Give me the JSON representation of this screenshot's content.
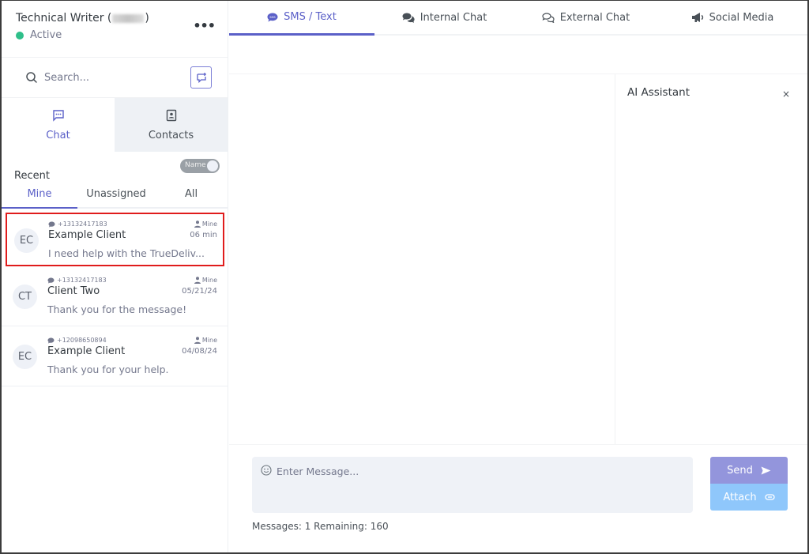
{
  "user": {
    "name_prefix": "Technical Writer (",
    "name_suffix": ")",
    "status": "Active",
    "status_color": "#2fbf8a",
    "more_icon": "ellipsis-icon"
  },
  "search": {
    "placeholder": "Search...",
    "value": "",
    "new_chat_icon": "new-message-icon"
  },
  "mode_tabs": [
    {
      "label": "Chat",
      "icon": "chat-icon",
      "active": true
    },
    {
      "label": "Contacts",
      "icon": "contact-book-icon",
      "active": false
    }
  ],
  "recent": {
    "label": "Recent",
    "toggle_label": "Name"
  },
  "filter_tabs": [
    {
      "label": "Mine",
      "active": true
    },
    {
      "label": "Unassigned",
      "active": false
    },
    {
      "label": "All",
      "active": false
    }
  ],
  "conversations": [
    {
      "initials": "EC",
      "phone": "+13132417183",
      "name": "Example Client",
      "preview": "I need help with the TrueDeliv...",
      "owner": "Mine",
      "time": "06 min",
      "selected": true
    },
    {
      "initials": "CT",
      "phone": "+13132417183",
      "name": "Client Two",
      "preview": "Thank you for the message!",
      "owner": "Mine",
      "time": "05/21/24",
      "selected": false
    },
    {
      "initials": "EC",
      "phone": "+12098650894",
      "name": "Example Client",
      "preview": "Thank you for your help.",
      "owner": "Mine",
      "time": "04/08/24",
      "selected": false
    }
  ],
  "channel_tabs": [
    {
      "label": "SMS / Text",
      "icon": "sms-bubble-icon",
      "active": true
    },
    {
      "label": "Internal Chat",
      "icon": "comments-icon",
      "active": false
    },
    {
      "label": "External Chat",
      "icon": "comments-outline-icon",
      "active": false
    },
    {
      "label": "Social Media",
      "icon": "megaphone-icon",
      "active": false
    }
  ],
  "ai_assistant": {
    "title": "AI Assistant",
    "close": "×"
  },
  "composer": {
    "placeholder": "Enter Message...",
    "value": "",
    "counter": "Messages: 1 Remaining: 160",
    "send_label": "Send",
    "attach_label": "Attach"
  },
  "colors": {
    "accent": "#5b60c8",
    "send": "#9395dc",
    "attach": "#8fc7fb",
    "selected_outline": "#e01c1c"
  }
}
